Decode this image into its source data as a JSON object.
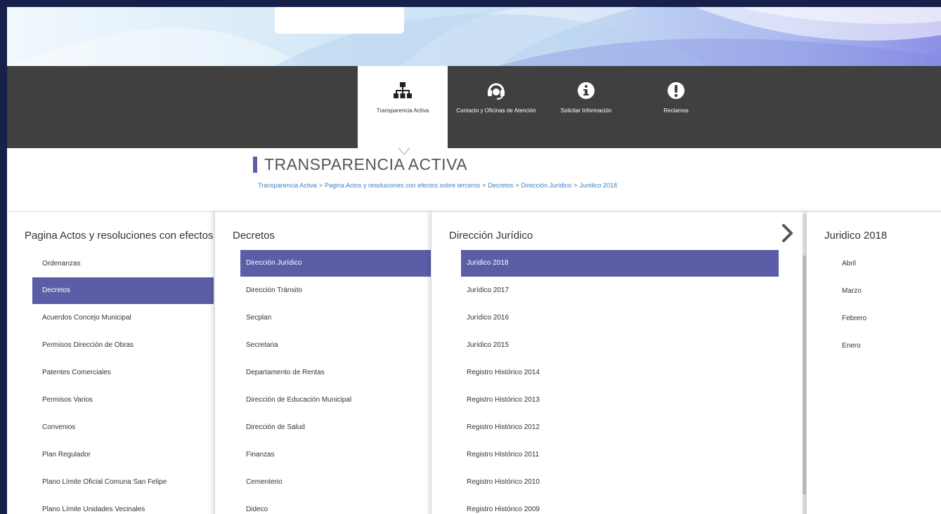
{
  "nav": [
    {
      "label": "Transparencia Activa",
      "icon": "sitemap-icon",
      "active": true
    },
    {
      "label": "Contacto y Oficinas de Atención",
      "icon": "headset-icon",
      "active": false
    },
    {
      "label": "Solicitar Información",
      "icon": "info-icon",
      "active": false
    },
    {
      "label": "Reclamos",
      "icon": "exclamation-icon",
      "active": false
    }
  ],
  "page": {
    "title": "TRANSPARENCIA ACTIVA",
    "breadcrumb": [
      "Transparencia Activa",
      "Pagina Actos y resoluciones con efectos sobre terceros",
      "Decretos",
      "Dirección Jurídico",
      "Juridico 2018"
    ],
    "breadcrumb_sep": ">"
  },
  "columns": [
    {
      "title": "Pagina Actos y resoluciones con efectos sobre terceros",
      "selected": 1,
      "items": [
        "Ordenanzas",
        "Decretos",
        "Acuerdos Concejo Municipal",
        "Permisos Dirección de Obras",
        "Patentes Comerciales",
        "Permisos Varios",
        "Convenios",
        "Plan Regulador",
        "Plano Límite Oficial Comuna San Felipe",
        "Plano Límite Unidades Vecinales"
      ]
    },
    {
      "title": "Decretos",
      "selected": 0,
      "items": [
        "Dirección Jurídico",
        "Dirección Tránsito",
        "Secplan",
        "Secretaria",
        "Departamento de Rentas",
        "Dirección de Educación Municipal",
        "Dirección de Salud",
        "Finanzas",
        "Cementerio",
        "Dideco"
      ]
    },
    {
      "title": "Dirección Jurídico",
      "selected": 0,
      "items": [
        "Juridico 2018",
        "Jurídico 2017",
        "Jurídico 2016",
        "Jurídico 2015",
        "Registro Histórico 2014",
        "Registro Histórico 2013",
        "Registro Histórico 2012",
        "Registro Histórico 2011",
        "Registro Histórico 2010",
        "Registro Histórico 2009"
      ]
    },
    {
      "title": "Juridico 2018",
      "selected": -1,
      "items": [
        "Abril",
        "Marzo",
        "Febrero",
        "Enero"
      ]
    }
  ],
  "colors": {
    "accent": "#5b5ea6",
    "navbar": "#404040",
    "link": "#3d7fc4"
  }
}
